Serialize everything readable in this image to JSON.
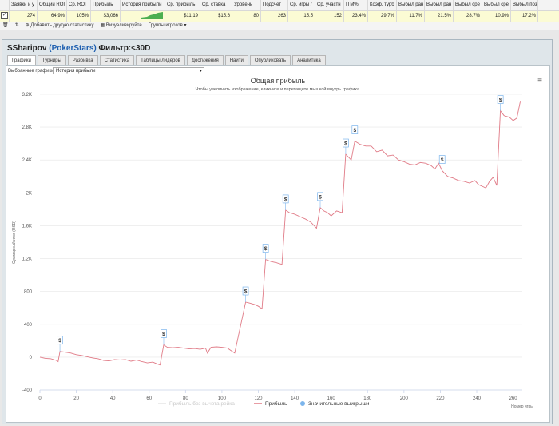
{
  "stats_table": {
    "headers": [
      "Заявки и у",
      "Общий ROI",
      "Ср. ROI",
      "Прибыль",
      "История прибыли",
      "Ср. прибыль",
      "Ср. ставка",
      "Уровень",
      "Подсчет",
      "Ср. игры /",
      "Ср. участн",
      "ITM%",
      "Коэф. турб",
      "Выбыл ран",
      "Выбыл ран",
      "Выбыл сре",
      "Выбыл сре",
      "Выбыл поз"
    ],
    "values": [
      "274",
      "64.9%",
      "105%",
      "$3,066",
      "",
      "$11.19",
      "$15.6",
      "80",
      "263",
      "15.5",
      "152",
      "23.4%",
      "29.7%",
      "11.7%",
      "21.5%",
      "28.7%",
      "10.9%",
      "17.2%"
    ]
  },
  "toolbar": {
    "add_stat": "Добавить другую статистику",
    "visualize": "Визуализируйте",
    "player_groups": "Группы игроков ▾"
  },
  "window": {
    "player": "SSharipov",
    "site": "(PokerStars)",
    "filter": "Фильтр:<30D",
    "tabs": [
      "Графики",
      "Турниры",
      "Разбивка",
      "Статистика",
      "Таблицы лидеров",
      "Достижения",
      "Найти",
      "Опубликовать",
      "Аналитика"
    ],
    "selected_label": "Выбранные графики:",
    "selected_value": "История прибыли"
  },
  "chart_data": {
    "type": "line",
    "title": "Общая прибыль",
    "subtitle": "Чтобы увеличить изображение, кликните и перетащите мышкой внутрь графика.",
    "xlabel": "Номер игры",
    "ylabel": "Суммарный итог (USD)",
    "xlim": [
      0,
      265
    ],
    "ylim": [
      -400,
      3200
    ],
    "x_ticks": [
      0,
      20,
      40,
      60,
      80,
      100,
      120,
      140,
      160,
      180,
      200,
      220,
      240,
      260
    ],
    "y_ticks": [
      "-400",
      "0",
      "400",
      "800",
      "1.2K",
      "1.6K",
      "2K",
      "2.4K",
      "2.8K",
      "3.2K"
    ],
    "y_tick_values": [
      -400,
      0,
      400,
      800,
      1200,
      1600,
      2000,
      2400,
      2800,
      3200
    ],
    "series": [
      {
        "name": "Прибыль без вычета рейка",
        "color": "#e6e6e6",
        "values": []
      },
      {
        "name": "Прибыль",
        "color": "#e07a86",
        "points": [
          [
            0,
            0
          ],
          [
            3,
            -15
          ],
          [
            6,
            -20
          ],
          [
            9,
            -40
          ],
          [
            10,
            -55
          ],
          [
            11,
            70
          ],
          [
            14,
            60
          ],
          [
            17,
            50
          ],
          [
            20,
            30
          ],
          [
            23,
            20
          ],
          [
            26,
            5
          ],
          [
            29,
            -10
          ],
          [
            32,
            -20
          ],
          [
            35,
            -40
          ],
          [
            38,
            -45
          ],
          [
            41,
            -30
          ],
          [
            44,
            -35
          ],
          [
            47,
            -30
          ],
          [
            50,
            -50
          ],
          [
            53,
            -35
          ],
          [
            56,
            -55
          ],
          [
            59,
            -70
          ],
          [
            62,
            -60
          ],
          [
            64,
            -80
          ],
          [
            66,
            -95
          ],
          [
            68,
            150
          ],
          [
            70,
            120
          ],
          [
            73,
            115
          ],
          [
            76,
            120
          ],
          [
            79,
            110
          ],
          [
            82,
            100
          ],
          [
            85,
            105
          ],
          [
            88,
            95
          ],
          [
            91,
            110
          ],
          [
            92,
            50
          ],
          [
            94,
            120
          ],
          [
            97,
            125
          ],
          [
            100,
            120
          ],
          [
            103,
            110
          ],
          [
            105,
            80
          ],
          [
            107,
            50
          ],
          [
            113,
            670
          ],
          [
            115,
            660
          ],
          [
            118,
            640
          ],
          [
            120,
            620
          ],
          [
            122,
            590
          ],
          [
            124,
            1190
          ],
          [
            127,
            1165
          ],
          [
            130,
            1150
          ],
          [
            133,
            1130
          ],
          [
            135,
            1790
          ],
          [
            137,
            1760
          ],
          [
            140,
            1740
          ],
          [
            143,
            1710
          ],
          [
            146,
            1680
          ],
          [
            149,
            1640
          ],
          [
            152,
            1570
          ],
          [
            154,
            1820
          ],
          [
            156,
            1780
          ],
          [
            158,
            1760
          ],
          [
            160,
            1720
          ],
          [
            163,
            1780
          ],
          [
            166,
            1760
          ],
          [
            168,
            2470
          ],
          [
            171,
            2400
          ],
          [
            173,
            2630
          ],
          [
            176,
            2590
          ],
          [
            179,
            2570
          ],
          [
            182,
            2570
          ],
          [
            185,
            2500
          ],
          [
            188,
            2520
          ],
          [
            191,
            2450
          ],
          [
            194,
            2460
          ],
          [
            197,
            2400
          ],
          [
            200,
            2380
          ],
          [
            203,
            2350
          ],
          [
            206,
            2340
          ],
          [
            209,
            2370
          ],
          [
            212,
            2360
          ],
          [
            215,
            2330
          ],
          [
            217,
            2290
          ],
          [
            219,
            2360
          ],
          [
            221,
            2270
          ],
          [
            224,
            2200
          ],
          [
            227,
            2180
          ],
          [
            230,
            2150
          ],
          [
            233,
            2140
          ],
          [
            236,
            2120
          ],
          [
            239,
            2150
          ],
          [
            241,
            2100
          ],
          [
            243,
            2080
          ],
          [
            245,
            2060
          ],
          [
            247,
            2140
          ],
          [
            249,
            2190
          ],
          [
            251,
            2090
          ],
          [
            253,
            3000
          ],
          [
            255,
            2940
          ],
          [
            258,
            2920
          ],
          [
            260,
            2880
          ],
          [
            262,
            2910
          ],
          [
            264,
            3120
          ]
        ]
      },
      {
        "name": "Значительные выигрыши",
        "color": "#7cb5ec",
        "markers": [
          [
            11,
            70
          ],
          [
            68,
            150
          ],
          [
            113,
            670
          ],
          [
            124,
            1190
          ],
          [
            135,
            1790
          ],
          [
            154,
            1820
          ],
          [
            168,
            2470
          ],
          [
            173,
            2630
          ],
          [
            221,
            2270
          ],
          [
            253,
            3000
          ]
        ]
      }
    ],
    "marker_label": "$",
    "legend_position": "bottom"
  }
}
